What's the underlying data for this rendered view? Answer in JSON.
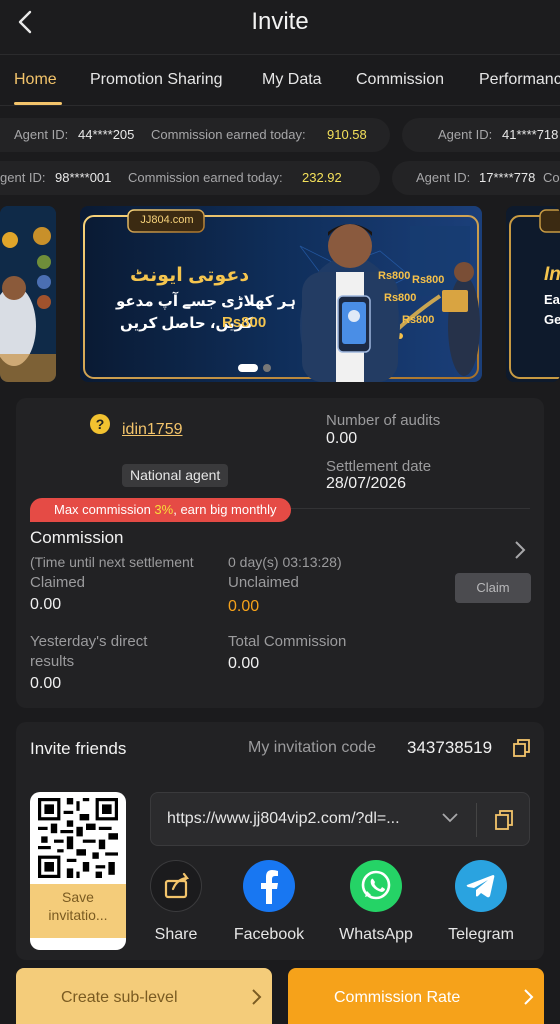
{
  "header": {
    "title": "Invite"
  },
  "tabs": [
    "Home",
    "Promotion Sharing",
    "My Data",
    "Commission",
    "Performance"
  ],
  "tickers": {
    "row1": [
      {
        "agent_label": "Agent ID:",
        "agent_id": "44****205",
        "earned_label": "Commission earned today:",
        "amount": "910.58"
      },
      {
        "agent_label": "Agent ID:",
        "agent_id": "41****718"
      }
    ],
    "row2": [
      {
        "agent_label": "gent ID:",
        "agent_id": "98****001",
        "earned_label": "Commission earned today:",
        "amount": "232.92"
      },
      {
        "agent_label": "Agent ID:",
        "agent_id": "17****778",
        "earned_label": "Con"
      }
    ]
  },
  "banner": {
    "brand": "JJ804.com",
    "headline": "دعوتی ایونٹ",
    "line1": "ہر کھلاڑی جسے آپ مدعو",
    "line2": "کریں، حاصل کریں",
    "amount": "Rs800",
    "partial_right_text": [
      "In",
      "Eac",
      "Get"
    ],
    "phone_tags": [
      "Rs800",
      "Rs800",
      "Rs800",
      "Rs800"
    ]
  },
  "account": {
    "help_symbol": "?",
    "username": "idin1759",
    "badge": "National agent",
    "audits_label": "Number of audits",
    "audits_value": "0.00",
    "settlement_label": "Settlement date",
    "settlement_value": "28/07/2026",
    "promo_prefix": "Max commission ",
    "promo_highlight": "3%",
    "promo_suffix": ", earn big monthly",
    "commission_title": "Commission",
    "countdown_label": "(Time until next settlement",
    "countdown_value": "0 day(s) 03:13:28)",
    "claimed_label": "Claimed",
    "claimed_value": "0.00",
    "unclaimed_label": "Unclaimed",
    "unclaimed_value": "0.00",
    "claim_button": "Claim",
    "yesterday_label_1": "Yesterday's direct",
    "yesterday_label_2": "results",
    "yesterday_value": "0.00",
    "total_label": "Total Commission",
    "total_value": "0.00"
  },
  "invite": {
    "title": "Invite friends",
    "code_label": "My invitation code",
    "code_value": "343738519",
    "link": "https://www.jj804vip2.com/?dl=...",
    "save_label_1": "Save",
    "save_label_2": "invitatio...",
    "share": [
      {
        "label": "Share",
        "icon": "share-icon"
      },
      {
        "label": "Facebook",
        "icon": "facebook-icon"
      },
      {
        "label": "WhatsApp",
        "icon": "whatsapp-icon"
      },
      {
        "label": "Telegram",
        "icon": "telegram-icon"
      }
    ]
  },
  "bottom_actions": {
    "create_sub_level": "Create sub-level",
    "commission_rate": "Commission Rate"
  },
  "colors": {
    "accent": "#f3c46b",
    "background": "#1b1b1d",
    "card": "#222224",
    "orange": "#f6a21a",
    "promo_red": "#e54b45"
  }
}
